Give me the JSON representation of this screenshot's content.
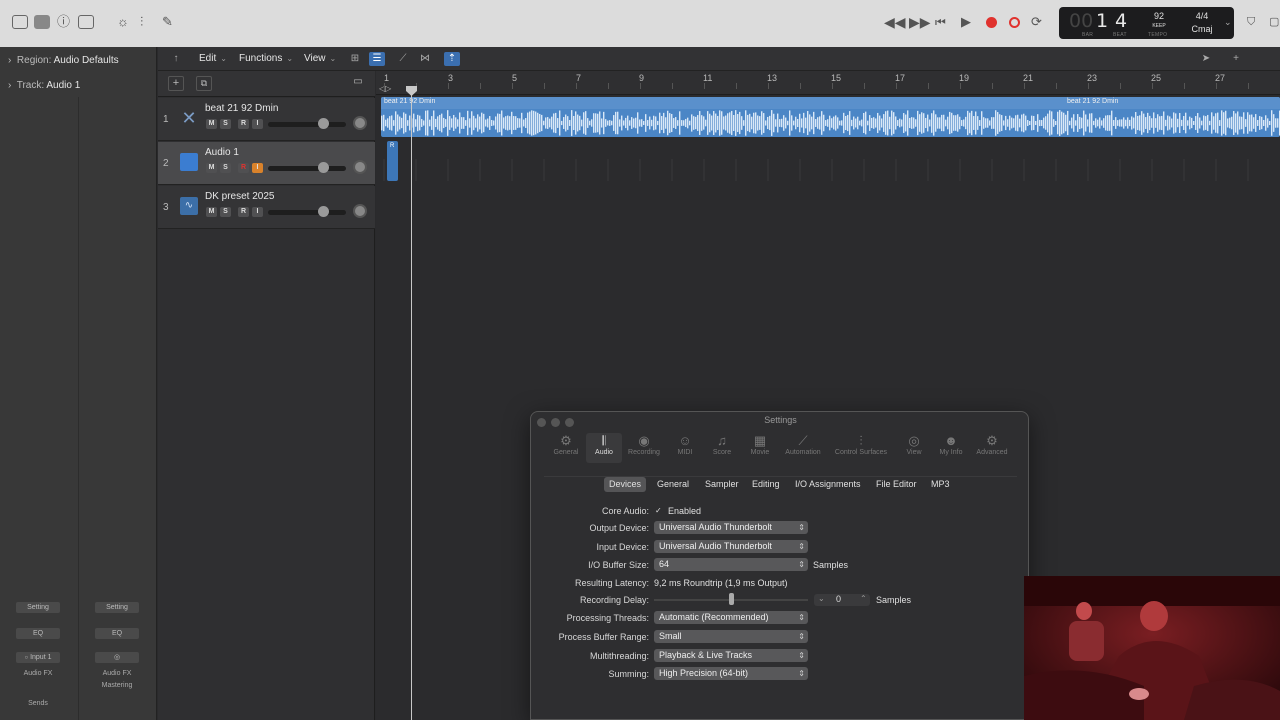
{
  "transport": {
    "bar": "1",
    "beat": "4",
    "bar_dim": "00",
    "tempo": "92",
    "tempo_mode": "KEEP",
    "signature": "4/4",
    "key": "Cmaj",
    "labels": {
      "bar": "BAR",
      "beat": "BEAT",
      "tempo": "TEMPO"
    }
  },
  "inspector": {
    "region_prefix": "Region:",
    "region_value": "Audio Defaults",
    "track_prefix": "Track:",
    "track_value": "Audio 1",
    "strips": [
      {
        "setting": "Setting",
        "eq": "EQ",
        "input": "Input 1",
        "fx": "Audio FX",
        "extra": ""
      },
      {
        "setting": "Setting",
        "eq": "EQ",
        "input": "",
        "fx": "Audio FX",
        "extra": "Mastering"
      }
    ],
    "sends": "Sends"
  },
  "local_menu": {
    "edit": "Edit",
    "functions": "Functions",
    "view": "View"
  },
  "tracks": [
    {
      "num": "1",
      "name": "beat 21 92 Dmin",
      "color": "#4e6d95"
    },
    {
      "num": "2",
      "name": "Audio 1",
      "color": "#3b7dd1"
    },
    {
      "num": "3",
      "name": "DK preset 2025",
      "color": "#3c6fa8"
    }
  ],
  "track_buttons": {
    "m": "M",
    "s": "S",
    "r": "R",
    "i": "I"
  },
  "ruler": {
    "bars": [
      "1",
      "3",
      "5",
      "7",
      "9",
      "11",
      "13",
      "15",
      "17",
      "19",
      "21",
      "23",
      "25",
      "27"
    ]
  },
  "region": {
    "label_1": "beat 21 92 Dmin",
    "label_2": "beat 21 92 Dmin",
    "rec_label": "R"
  },
  "settings": {
    "title": "Settings",
    "tabs": [
      {
        "label": "General",
        "glyph": "⚙"
      },
      {
        "label": "Audio",
        "glyph": "𝄃"
      },
      {
        "label": "Recording",
        "glyph": "◉"
      },
      {
        "label": "MIDI",
        "glyph": "☺"
      },
      {
        "label": "Score",
        "glyph": "♫"
      },
      {
        "label": "Movie",
        "glyph": "▦"
      },
      {
        "label": "Automation",
        "glyph": "⟋"
      },
      {
        "label": "Control Surfaces",
        "glyph": "⫶"
      },
      {
        "label": "View",
        "glyph": "◎"
      },
      {
        "label": "My Info",
        "glyph": "☻"
      },
      {
        "label": "Advanced",
        "glyph": "⚙"
      }
    ],
    "subtabs": [
      "Devices",
      "General",
      "Sampler",
      "Editing",
      "I/O Assignments",
      "File Editor",
      "MP3"
    ],
    "core_audio_label": "Core Audio:",
    "core_audio_value": "Enabled",
    "output_label": "Output Device:",
    "output_value": "Universal Audio Thunderbolt",
    "input_label": "Input Device:",
    "input_value": "Universal Audio Thunderbolt",
    "buffer_label": "I/O Buffer Size:",
    "buffer_value": "64",
    "buffer_unit": "Samples",
    "latency_label": "Resulting Latency:",
    "latency_value": "9,2 ms Roundtrip (1,9 ms Output)",
    "rec_delay_label": "Recording Delay:",
    "rec_delay_value": "0",
    "rec_delay_unit": "Samples",
    "threads_label": "Processing Threads:",
    "threads_value": "Automatic (Recommended)",
    "pbr_label": "Process Buffer Range:",
    "pbr_value": "Small",
    "mt_label": "Multithreading:",
    "mt_value": "Playback & Live Tracks",
    "summing_label": "Summing:",
    "summing_value": "High Precision (64-bit)"
  }
}
